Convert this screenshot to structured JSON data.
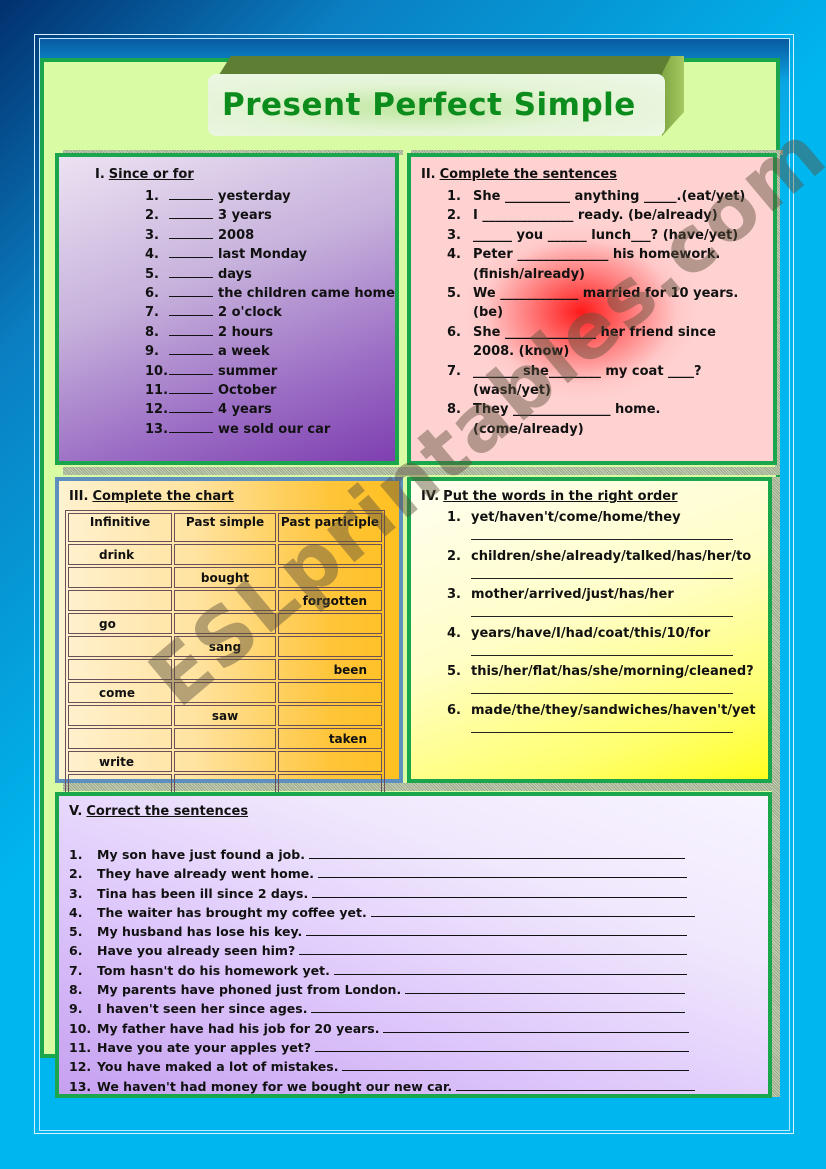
{
  "title": "Present Perfect Simple",
  "watermark": "ESLprintables.com",
  "section1": {
    "number": "I.",
    "heading": "Since or for",
    "items": [
      {
        "n": "1.",
        "text": "yesterday"
      },
      {
        "n": "2.",
        "text": "3 years"
      },
      {
        "n": "3.",
        "text": "2008"
      },
      {
        "n": "4.",
        "text": "last Monday"
      },
      {
        "n": "5.",
        "text": "days"
      },
      {
        "n": "6.",
        "text": "the children came home"
      },
      {
        "n": "7.",
        "text": "2 o'clock"
      },
      {
        "n": "8.",
        "text": "2 hours"
      },
      {
        "n": "9.",
        "text": "a week"
      },
      {
        "n": "10.",
        "text": "summer"
      },
      {
        "n": "11.",
        "text": "October"
      },
      {
        "n": "12.",
        "text": "4 years"
      },
      {
        "n": "13.",
        "text": "we sold our car"
      }
    ]
  },
  "section2": {
    "number": "II.",
    "heading": "Complete the sentences",
    "items": [
      {
        "n": "1.",
        "text": "She __________ anything _____.(eat/yet)"
      },
      {
        "n": "2.",
        "text": "I ______________ ready. (be/already)"
      },
      {
        "n": "3.",
        "text": "______ you ______ lunch___? (have/yet)"
      },
      {
        "n": "4.",
        "text": "Peter ______________ his homework.\n(finish/already)"
      },
      {
        "n": "5.",
        "text": "We ____________ married for 10 years.\n(be)"
      },
      {
        "n": "6.",
        "text": "She ______________ her friend since\n2008. (know)"
      },
      {
        "n": "7.",
        "text": "_______ she________ my coat ____?\n(wash/yet)"
      },
      {
        "n": "8.",
        "text": "They _______________ home.\n(come/already)"
      }
    ]
  },
  "section3": {
    "number": "III.",
    "heading": "Complete the chart",
    "columns": [
      "Infinitive",
      "Past simple",
      "Past participle"
    ],
    "rows": [
      [
        "drink",
        "",
        ""
      ],
      [
        "",
        "bought",
        ""
      ],
      [
        "",
        "",
        "forgotten"
      ],
      [
        "go",
        "",
        ""
      ],
      [
        "",
        "sang",
        ""
      ],
      [
        "",
        "",
        "been"
      ],
      [
        "come",
        "",
        ""
      ],
      [
        "",
        "saw",
        ""
      ],
      [
        "",
        "",
        "taken"
      ],
      [
        "write",
        "",
        ""
      ],
      [
        "",
        "",
        ""
      ]
    ]
  },
  "section4": {
    "number": "IV.",
    "heading": "Put the words in the right order",
    "items": [
      {
        "n": "1.",
        "text": "yet/haven't/come/home/they"
      },
      {
        "n": "2.",
        "text": "children/she/already/talked/has/her/to"
      },
      {
        "n": "3.",
        "text": "mother/arrived/just/has/her"
      },
      {
        "n": "4.",
        "text": "years/have/I/had/coat/this/10/for"
      },
      {
        "n": "5.",
        "text": "this/her/flat/has/she/morning/cleaned?"
      },
      {
        "n": "6.",
        "text": "made/the/they/sandwiches/haven't/yet"
      }
    ]
  },
  "section5": {
    "number": "V.",
    "heading": "Correct the sentences",
    "items": [
      {
        "n": "1.",
        "text": "My son have just found a job."
      },
      {
        "n": "2.",
        "text": "They have already went home."
      },
      {
        "n": "3.",
        "text": "Tina has been ill since 2 days."
      },
      {
        "n": "4.",
        "text": "The waiter has brought my coffee yet."
      },
      {
        "n": "5.",
        "text": "My husband has lose his key."
      },
      {
        "n": "6.",
        "text": "Have you already seen him?"
      },
      {
        "n": "7.",
        "text": "Tom hasn't do his homework yet."
      },
      {
        "n": "8.",
        "text": "My parents have phoned just from London."
      },
      {
        "n": "9.",
        "text": "I haven't seen her since ages."
      },
      {
        "n": "10.",
        "text": "My father have had his job for 20 years."
      },
      {
        "n": "11.",
        "text": "Have you ate your apples yet?"
      },
      {
        "n": "12.",
        "text": "You have maked a lot of mistakes."
      },
      {
        "n": "13.",
        "text": "We haven't had money for we bought our new car."
      }
    ]
  }
}
